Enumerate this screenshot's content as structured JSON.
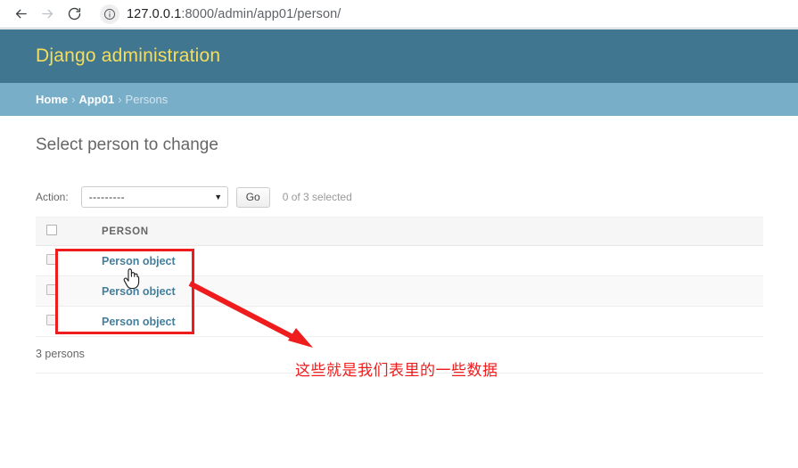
{
  "browser": {
    "back_icon": "back-arrow-icon",
    "forward_icon": "forward-arrow-icon",
    "reload_icon": "reload-icon",
    "info_icon": "info-circle-icon",
    "url_host": "127.0.0.1",
    "url_rest": ":8000/admin/app01/person/",
    "url_full": "127.0.0.1:8000/admin/app01/person/"
  },
  "header": {
    "title": "Django administration",
    "title_color": "#f5dd5d",
    "bg_color": "#417690"
  },
  "breadcrumb": {
    "bg_color": "#79aec8",
    "home": "Home",
    "sep": "›",
    "app": "App01",
    "current": "Persons"
  },
  "main": {
    "page_title": "Select person to change",
    "actions": {
      "label": "Action:",
      "selected_option": "---------",
      "caret_icon": "chevron-down-icon",
      "go_label": "Go",
      "selection_count": "0 of 3 selected"
    },
    "table": {
      "columns": [
        "",
        "PERSON"
      ],
      "rows": [
        {
          "checked": false,
          "name": "Person object"
        },
        {
          "checked": false,
          "name": "Person object"
        },
        {
          "checked": false,
          "name": "Person object"
        }
      ]
    },
    "result_count": "3 persons"
  },
  "annotations": {
    "highlight_color": "#ee1c1c",
    "note_text": "这些就是我们表里的一些数据",
    "box_label": "red-highlight-box",
    "arrow_label": "red-arrow",
    "cursor_label": "hand-cursor"
  }
}
